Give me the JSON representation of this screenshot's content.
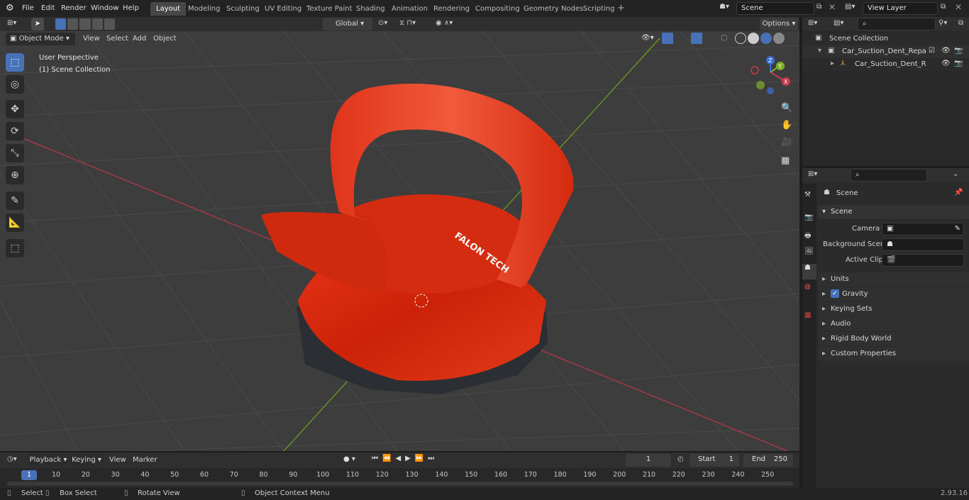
{
  "menus": [
    "File",
    "Edit",
    "Render",
    "Window",
    "Help"
  ],
  "workspaces": [
    "Layout",
    "Modeling",
    "Sculpting",
    "UV Editing",
    "Texture Paint",
    "Shading",
    "Animation",
    "Rendering",
    "Compositing",
    "Geometry Nodes",
    "Scripting"
  ],
  "active_workspace": "Layout",
  "scene_field": "Scene",
  "view_layer_field": "View Layer",
  "viewport_header": {
    "transform_orientation": "Global",
    "options": "Options",
    "mode": "Object Mode",
    "view": "View",
    "select": "Select",
    "add": "Add",
    "object": "Object"
  },
  "viewport_overlay": {
    "perspective": "User Perspective",
    "collection": "(1) Scene Collection",
    "model_logo_text": "FALON TECH"
  },
  "outliner": {
    "root": "Scene Collection",
    "items": [
      "Car_Suction_Dent_Repair_Pul",
      "Car_Suction_Dent_Repair"
    ]
  },
  "properties": {
    "header": "Scene",
    "panel": "Scene",
    "camera_label": "Camera",
    "background_label": "Background Scene",
    "active_clip_label": "Active Clip",
    "sections": [
      "Units",
      "Gravity",
      "Keying Sets",
      "Audio",
      "Rigid Body World",
      "Custom Properties"
    ]
  },
  "timeline": {
    "playback": "Playback",
    "keying": "Keying",
    "view": "View",
    "marker": "Marker",
    "current_frame": "1",
    "start_label": "Start",
    "start": "1",
    "end_label": "End",
    "end": "250",
    "ticks": [
      "1",
      "10",
      "20",
      "30",
      "40",
      "50",
      "60",
      "70",
      "80",
      "90",
      "100",
      "110",
      "120",
      "130",
      "140",
      "150",
      "160",
      "170",
      "180",
      "190",
      "200",
      "210",
      "220",
      "230",
      "240",
      "250"
    ]
  },
  "status": {
    "select": "Select",
    "box_select": "Box Select",
    "rotate_view": "Rotate View",
    "context_menu": "Object Context Menu",
    "version": "2.93.16"
  },
  "colors": {
    "accent": "#4872b8",
    "model_red": "#d8280c",
    "x_axis": "#b03a44",
    "y_axis": "#6a9a1e"
  }
}
